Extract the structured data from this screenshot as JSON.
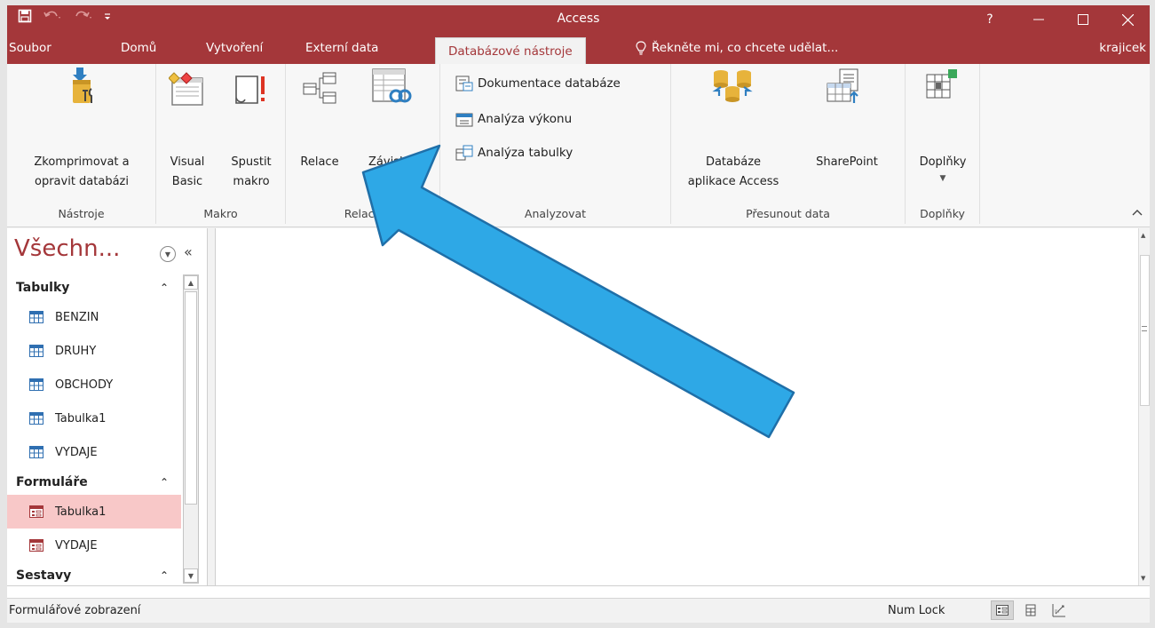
{
  "window": {
    "title": "Access",
    "help": "?",
    "minimize": "—",
    "maximize": "☐",
    "close": "✕"
  },
  "tabs": [
    {
      "label": "Soubor"
    },
    {
      "label": "Domů"
    },
    {
      "label": "Vytvoření"
    },
    {
      "label": "Externí data"
    },
    {
      "label": "Databázové nástroje",
      "active": true
    }
  ],
  "tell_me": "Řekněte mi, co chcete udělat...",
  "user": "krajicek",
  "ribbon": {
    "groups": {
      "nastroje": {
        "label": "Nástroje",
        "compact": {
          "line1": "Zkomprimovat a",
          "line2": "opravit databázi"
        }
      },
      "makro": {
        "label": "Makro",
        "visual_basic": {
          "line1": "Visual",
          "line2": "Basic"
        },
        "spustit": {
          "line1": "Spustit",
          "line2": "makro"
        }
      },
      "relace": {
        "label": "Relace",
        "relace": {
          "line1": "Relace"
        },
        "zavislosti": {
          "line1": "Závislosti"
        }
      },
      "analyzovat": {
        "label": "Analyzovat",
        "items": [
          {
            "label": "Dokumentace databáze"
          },
          {
            "label": "Analýza výkonu"
          },
          {
            "label": "Analýza tabulky"
          }
        ]
      },
      "presunout": {
        "label": "Přesunout data",
        "databaze": {
          "line1": "Databáze",
          "line2": "aplikace Access"
        },
        "sharepoint": {
          "line1": "SharePoint"
        }
      },
      "doplnky": {
        "label": "Doplňky",
        "doplnky": {
          "line1": "Doplňky"
        }
      }
    }
  },
  "nav": {
    "title": "Všechn...",
    "sections": [
      {
        "name": "Tabulky",
        "items": [
          "BENZIN",
          "DRUHY",
          "OBCHODY",
          "Tabulka1",
          "VYDAJE"
        ]
      },
      {
        "name": "Formuláře",
        "items": [
          "Tabulka1",
          "VYDAJE"
        ]
      },
      {
        "name": "Sestavy",
        "items": []
      }
    ]
  },
  "status": {
    "left": "Formulářové zobrazení",
    "numlock": "Num Lock"
  },
  "colors": {
    "accent": "#a4373a",
    "selected_row": "#f8c8c8",
    "arrow_fill": "#2ea8e6",
    "arrow_stroke": "#1f6fa8"
  }
}
